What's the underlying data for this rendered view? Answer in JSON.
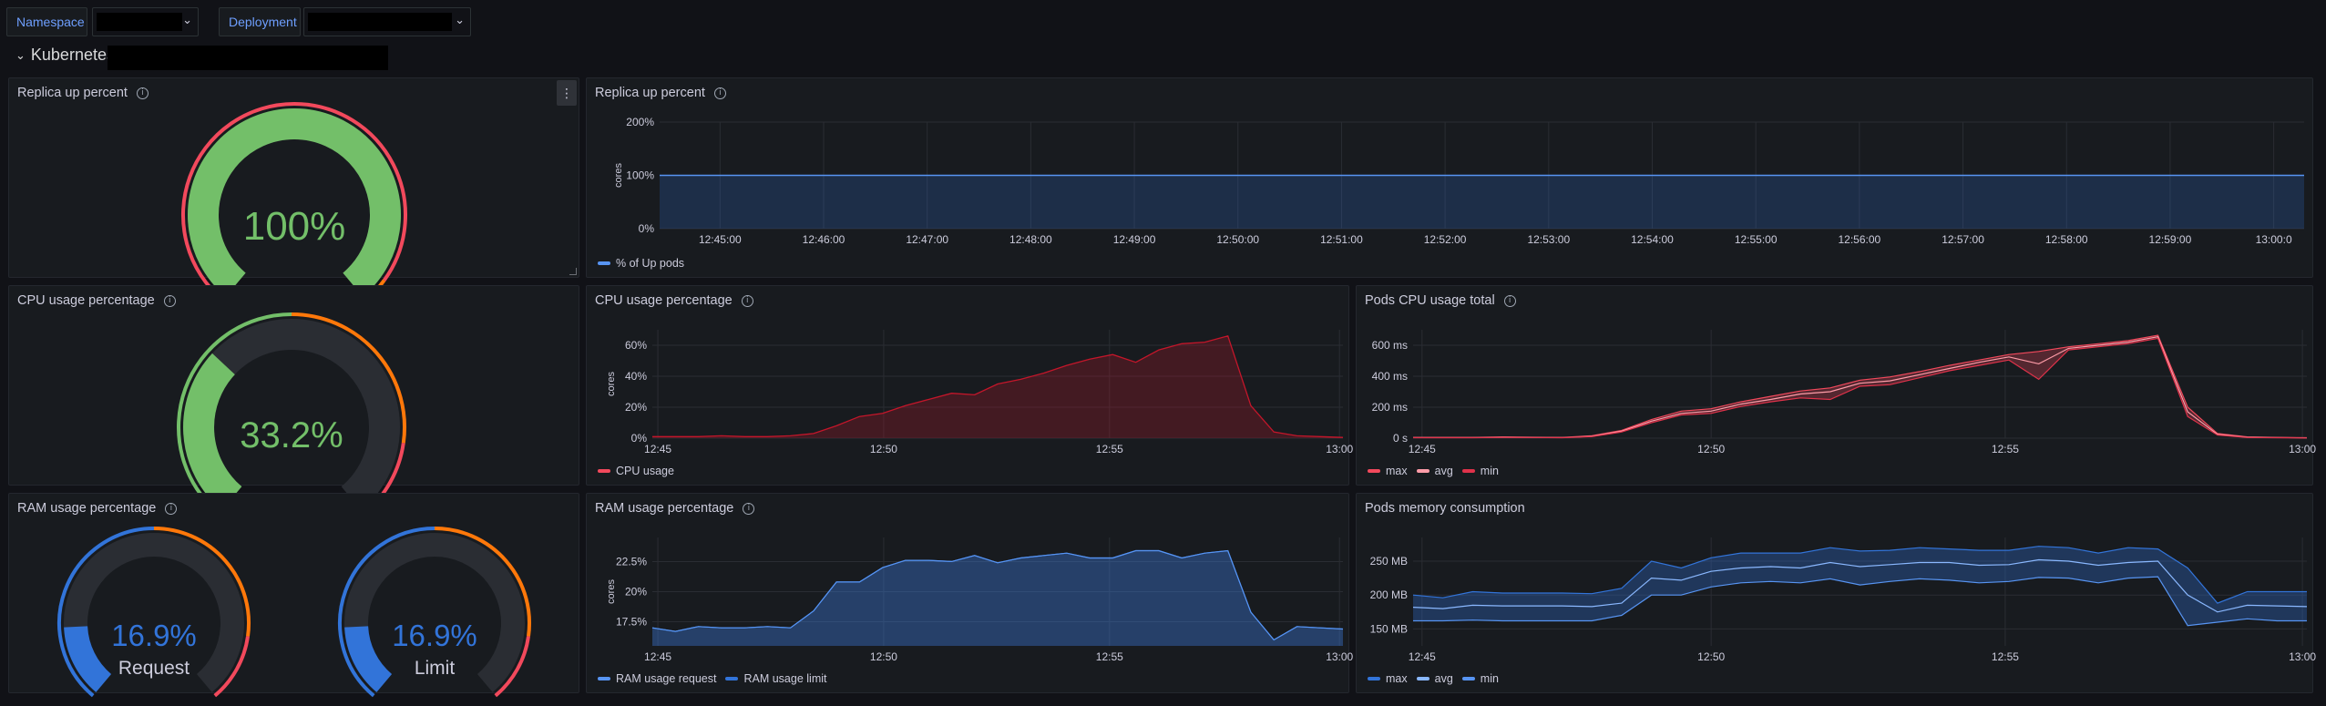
{
  "variables": {
    "namespace_label": "Namespace",
    "deployment_label": "Deployment"
  },
  "row": {
    "title": "Kubernetes"
  },
  "colors": {
    "green": "#73bf69",
    "orange": "#ff780a",
    "red": "#f2495c",
    "blue": "#5794f2",
    "blue_gauge": "#3274d9",
    "dark_red": "#e0324a"
  },
  "panels": {
    "replica_gauge": {
      "title": "Replica up percent",
      "value": 100,
      "value_text": "100%"
    },
    "replica_chart": {
      "title": "Replica up percent",
      "ylabel": "cores",
      "yticks": [
        "200%",
        "100%",
        "0%"
      ],
      "xticks": [
        "12:45:00",
        "12:46:00",
        "12:47:00",
        "12:48:00",
        "12:49:00",
        "12:50:00",
        "12:51:00",
        "12:52:00",
        "12:53:00",
        "12:54:00",
        "12:55:00",
        "12:56:00",
        "12:57:00",
        "12:58:00",
        "12:59:00",
        "13:00:0"
      ],
      "legend": [
        "% of Up pods"
      ]
    },
    "cpu_gauge": {
      "title": "CPU usage percentage",
      "value": 33.2,
      "value_text": "33.2%"
    },
    "cpu_chart": {
      "title": "CPU usage percentage",
      "ylabel": "cores",
      "yticks": [
        "60%",
        "40%",
        "20%",
        "0%"
      ],
      "xticks": [
        "12:45",
        "12:50",
        "12:55",
        "13:00"
      ],
      "legend": [
        "CPU usage"
      ]
    },
    "pods_cpu": {
      "title": "Pods CPU usage total",
      "yticks": [
        "600 ms",
        "400 ms",
        "200 ms",
        "0 s"
      ],
      "xticks": [
        "12:45",
        "12:50",
        "12:55",
        "13:00"
      ],
      "legend": [
        "max",
        "avg",
        "min"
      ]
    },
    "ram_gauge": {
      "title": "RAM usage percentage",
      "gauges": [
        {
          "label": "Request",
          "value": 16.9,
          "value_text": "16.9%"
        },
        {
          "label": "Limit",
          "value": 16.9,
          "value_text": "16.9%"
        }
      ]
    },
    "ram_chart": {
      "title": "RAM usage percentage",
      "ylabel": "cores",
      "yticks": [
        "22.5%",
        "20%",
        "17.5%"
      ],
      "xticks": [
        "12:45",
        "12:50",
        "12:55",
        "13:00"
      ],
      "legend": [
        "RAM usage request",
        "RAM usage limit"
      ]
    },
    "pods_mem": {
      "title": "Pods memory consumption",
      "yticks": [
        "250 MB",
        "200 MB",
        "150 MB"
      ],
      "xticks": [
        "12:45",
        "12:50",
        "12:55",
        "13:00"
      ],
      "legend": [
        "max",
        "avg",
        "min"
      ]
    }
  },
  "chart_data": [
    {
      "type": "area",
      "title": "Replica up percent",
      "ylabel": "cores",
      "x": [
        "12:45",
        "12:46",
        "12:47",
        "12:48",
        "12:49",
        "12:50",
        "12:51",
        "12:52",
        "12:53",
        "12:54",
        "12:55",
        "12:56",
        "12:57",
        "12:58",
        "12:59",
        "13:00"
      ],
      "series": [
        {
          "name": "% of Up pods",
          "values": [
            100,
            100,
            100,
            100,
            100,
            100,
            100,
            100,
            100,
            100,
            100,
            100,
            100,
            100,
            100,
            100
          ]
        }
      ],
      "ylim": [
        0,
        200
      ]
    },
    {
      "type": "area",
      "title": "CPU usage percentage",
      "ylabel": "cores",
      "x_minutes": [
        0,
        0.5,
        1,
        1.5,
        2,
        2.5,
        3,
        3.5,
        4,
        4.5,
        5,
        5.5,
        6,
        6.5,
        7,
        7.5,
        8,
        8.5,
        9,
        9.5,
        10,
        10.5,
        11,
        11.5,
        12,
        12.5,
        13,
        13.5,
        14,
        14.5,
        15
      ],
      "series": [
        {
          "name": "CPU usage",
          "values": [
            1,
            1,
            1,
            1.5,
            1,
            1,
            1.5,
            3,
            8,
            14,
            16,
            21,
            25,
            29,
            28,
            35,
            38,
            42,
            47,
            51,
            54,
            49,
            57,
            61,
            62,
            66,
            21,
            4,
            1.5,
            1,
            0.5
          ]
        }
      ],
      "ylim": [
        0,
        70
      ],
      "x_start": "12:45",
      "x_end": "13:00"
    },
    {
      "type": "line",
      "title": "Pods CPU usage total",
      "unit": "ms",
      "x_minutes": [
        0,
        0.5,
        1,
        1.5,
        2,
        2.5,
        3,
        3.5,
        4,
        4.5,
        5,
        5.5,
        6,
        6.5,
        7,
        7.5,
        8,
        8.5,
        9,
        9.5,
        10,
        10.5,
        11,
        11.5,
        12,
        12.5,
        13,
        13.5,
        14,
        14.5,
        15
      ],
      "series": [
        {
          "name": "max",
          "values": [
            5,
            5,
            5,
            8,
            6,
            5,
            15,
            50,
            120,
            175,
            190,
            235,
            270,
            305,
            325,
            375,
            395,
            430,
            470,
            505,
            540,
            560,
            590,
            610,
            630,
            665,
            200,
            30,
            8,
            5,
            3
          ]
        },
        {
          "name": "avg",
          "values": [
            4,
            4,
            4,
            6,
            5,
            4,
            12,
            45,
            110,
            160,
            175,
            220,
            250,
            285,
            300,
            355,
            370,
            410,
            450,
            490,
            525,
            480,
            580,
            600,
            620,
            655,
            170,
            25,
            6,
            4,
            2
          ]
        },
        {
          "name": "min",
          "values": [
            3,
            3,
            3,
            5,
            4,
            3,
            10,
            40,
            100,
            150,
            160,
            205,
            235,
            260,
            250,
            335,
            345,
            390,
            435,
            470,
            505,
            380,
            570,
            590,
            610,
            645,
            140,
            20,
            4,
            3,
            1
          ]
        }
      ],
      "ylim": [
        0,
        700
      ],
      "x_start": "12:45",
      "x_end": "13:00"
    },
    {
      "type": "area",
      "title": "RAM usage percentage",
      "ylabel": "cores",
      "x_minutes": [
        0,
        0.5,
        1,
        1.5,
        2,
        2.5,
        3,
        3.5,
        4,
        4.5,
        5,
        5.5,
        6,
        6.5,
        7,
        7.5,
        8,
        8.5,
        9,
        9.5,
        10,
        10.5,
        11,
        11.5,
        12,
        12.5,
        13,
        13.5,
        14,
        14.5,
        15
      ],
      "series": [
        {
          "name": "RAM usage request",
          "values": [
            17.0,
            16.7,
            17.1,
            17.0,
            17.0,
            17.1,
            17.0,
            18.4,
            20.8,
            20.8,
            22.0,
            22.6,
            22.6,
            22.5,
            23.0,
            22.4,
            22.8,
            23.0,
            23.2,
            22.8,
            22.8,
            23.4,
            23.4,
            22.8,
            23.2,
            23.4,
            18.3,
            16.0,
            17.1,
            17.0,
            16.9
          ]
        },
        {
          "name": "RAM usage limit",
          "values": [
            17.0,
            16.7,
            17.1,
            17.0,
            17.0,
            17.1,
            17.0,
            18.4,
            20.8,
            20.8,
            22.0,
            22.6,
            22.6,
            22.5,
            23.0,
            22.4,
            22.8,
            23.0,
            23.2,
            22.8,
            22.8,
            23.4,
            23.4,
            22.8,
            23.2,
            23.4,
            18.3,
            16.0,
            17.1,
            17.0,
            16.9
          ]
        }
      ],
      "ylim": [
        15.5,
        24.5
      ],
      "x_start": "12:45",
      "x_end": "13:00"
    },
    {
      "type": "area",
      "title": "Pods memory consumption",
      "unit": "MB",
      "x_minutes": [
        0,
        0.5,
        1,
        1.5,
        2,
        2.5,
        3,
        3.5,
        4,
        4.5,
        5,
        5.5,
        6,
        6.5,
        7,
        7.5,
        8,
        8.5,
        9,
        9.5,
        10,
        10.5,
        11,
        11.5,
        12,
        12.5,
        13,
        13.5,
        14,
        14.5,
        15
      ],
      "series": [
        {
          "name": "max",
          "values": [
            200,
            196,
            205,
            203,
            203,
            203,
            202,
            210,
            250,
            240,
            255,
            262,
            262,
            262,
            270,
            265,
            266,
            270,
            268,
            266,
            266,
            272,
            270,
            262,
            270,
            268,
            240,
            188,
            205,
            205,
            205
          ]
        },
        {
          "name": "avg",
          "values": [
            182,
            180,
            185,
            184,
            184,
            184,
            183,
            188,
            225,
            222,
            235,
            240,
            242,
            240,
            248,
            242,
            245,
            248,
            248,
            244,
            245,
            252,
            250,
            244,
            248,
            250,
            200,
            175,
            185,
            184,
            183
          ]
        },
        {
          "name": "min",
          "values": [
            162,
            162,
            163,
            162,
            162,
            162,
            162,
            170,
            200,
            200,
            212,
            218,
            220,
            218,
            224,
            215,
            220,
            224,
            222,
            218,
            220,
            226,
            225,
            218,
            225,
            227,
            155,
            160,
            165,
            162,
            162
          ]
        }
      ],
      "ylim": [
        125,
        285
      ],
      "x_start": "12:45",
      "x_end": "13:00"
    }
  ]
}
